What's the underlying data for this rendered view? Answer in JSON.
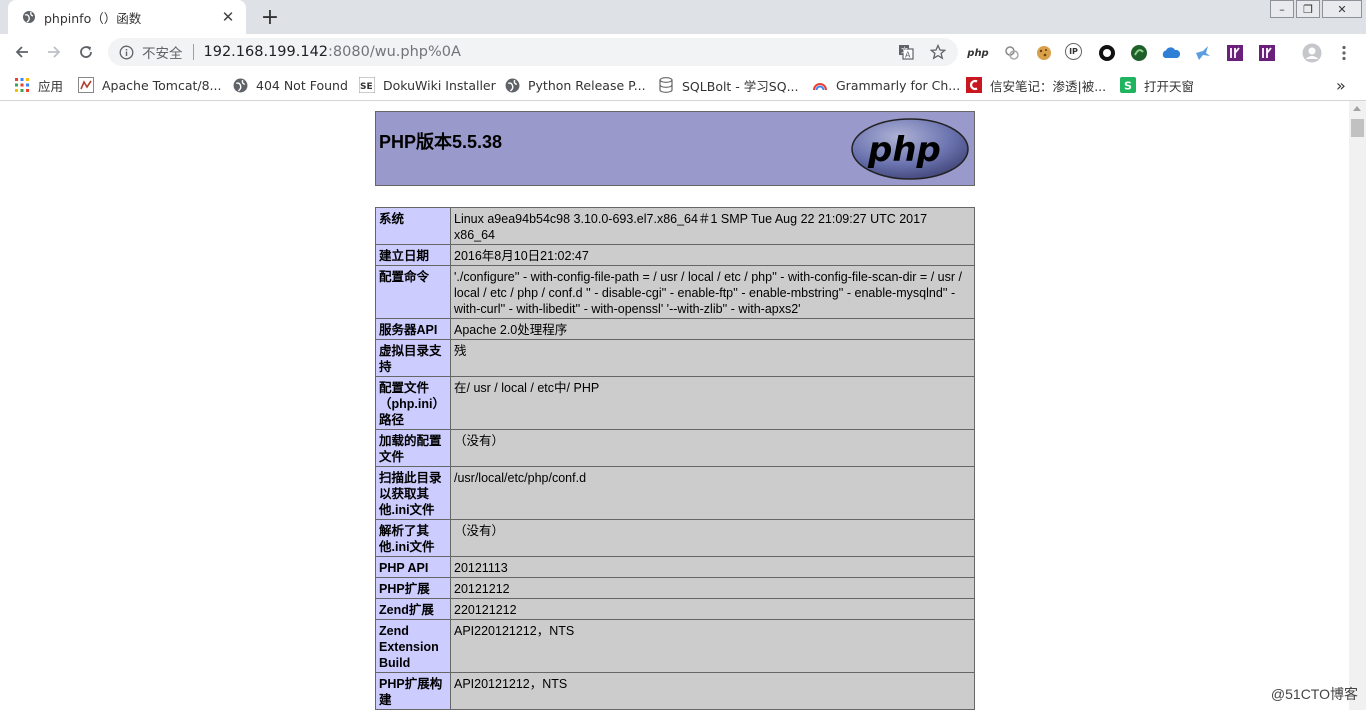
{
  "tab": {
    "title": "phpinfo（）函数",
    "close": "✕",
    "new": "+"
  },
  "window": {
    "minimize": "–",
    "restore": "❐",
    "close": "✕"
  },
  "toolbar": {
    "security_text": "不安全",
    "url_host": "192.168.199.142",
    "url_rest": ":8080/wu.php%0A"
  },
  "extensions": [
    "php",
    "IP"
  ],
  "bookmarks": [
    {
      "label": "应用"
    },
    {
      "label": "Apache Tomcat/8..."
    },
    {
      "label": "404 Not Found"
    },
    {
      "label": "DokuWiki Installer"
    },
    {
      "label": "Python Release P..."
    },
    {
      "label": "SQLBolt - 学习SQ..."
    },
    {
      "label": "Grammarly for Ch..."
    },
    {
      "label": "信安笔记：渗透|被..."
    },
    {
      "label": "打开天窗"
    }
  ],
  "bookmarks_more": "»",
  "page": {
    "title": "PHP版本5.5.38",
    "logo_text": "php",
    "rows": [
      {
        "key": "系统",
        "value": "Linux a9ea94b54c98 3.10.0-693.el7.x86_64＃1 SMP Tue Aug 22 21:09:27 UTC 2017 x86_64"
      },
      {
        "key": "建立日期",
        "value": "2016年8月10日21:02:47"
      },
      {
        "key": "配置命令",
        "value": "'./configure'' - with-config-file-path = / usr / local / etc / php'' - with-config-file-scan-dir = / usr / local / etc / php / conf.d '' - disable-cgi'' - enable-ftp'' - enable-mbstring'' - enable-mysqlnd'' - with-curl'' - with-libedit'' - with-openssl' '--with-zlib'' - with-apxs2'"
      },
      {
        "key": "服务器API",
        "value": "Apache 2.0处理程序"
      },
      {
        "key": "虚拟目录支持",
        "value": "残"
      },
      {
        "key": "配置文件（php.ini）路径",
        "value": "在/ usr / local / etc中/ PHP"
      },
      {
        "key": "加载的配置文件",
        "value": "（没有）"
      },
      {
        "key": "扫描此目录以获取其他.ini文件",
        "value": "/usr/local/etc/php/conf.d"
      },
      {
        "key": "解析了其他.ini文件",
        "value": "（没有）"
      },
      {
        "key": "PHP API",
        "value": "20121113"
      },
      {
        "key": "PHP扩展",
        "value": "20121212"
      },
      {
        "key": "Zend扩展",
        "value": "220121212"
      },
      {
        "key": "Zend Extension Build",
        "value": "API220121212，NTS"
      },
      {
        "key": "PHP扩展构建",
        "value": "API20121212，NTS"
      }
    ]
  },
  "watermark": "@51CTO博客",
  "colors": {
    "header_bg": "#9999cc",
    "key_bg": "#ccccff",
    "value_bg": "#cccccc",
    "tabstrip_bg": "#dee1e6"
  }
}
